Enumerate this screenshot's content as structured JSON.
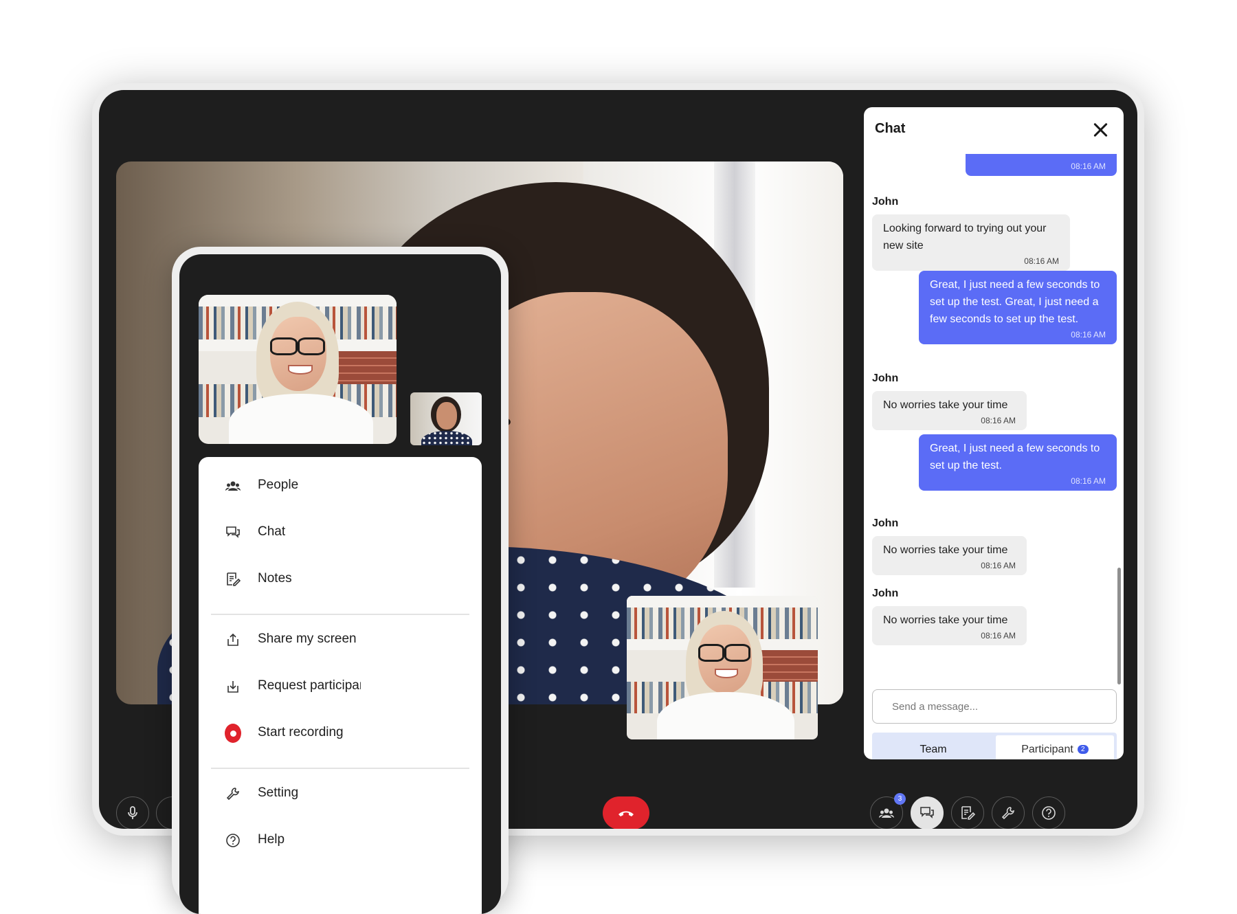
{
  "chat": {
    "title": "Chat",
    "messages": [
      {
        "sender": "",
        "text": "",
        "time": "08:16 AM",
        "own": true
      },
      {
        "sender": "John",
        "text": "Looking forward to trying out your new site",
        "time": "08:16 AM",
        "own": false
      },
      {
        "sender": "",
        "text": "Great, I just need a few seconds to set up the test. Great, I just need a few seconds to set up the test.",
        "time": "08:16 AM",
        "own": true
      },
      {
        "sender": "John",
        "text": "No worries take your time",
        "time": "08:16 AM",
        "own": false
      },
      {
        "sender": "",
        "text": "Great, I just need a few seconds to set up the test.",
        "time": "08:16 AM",
        "own": true
      },
      {
        "sender": "John",
        "text": "No worries take your time",
        "time": "08:16 AM",
        "own": false
      },
      {
        "sender": "John",
        "text": "No worries take your time",
        "time": "08:16 AM",
        "own": false
      }
    ],
    "input_placeholder": "Send a message...",
    "tabs": {
      "team": "Team",
      "participant": "Participant",
      "participant_count": "2"
    }
  },
  "controls": {
    "people_badge": "3",
    "icons": [
      "microphone-icon",
      "hang-up-icon",
      "people-icon",
      "chat-icon",
      "notes-icon",
      "settings-wrench-icon",
      "help-icon"
    ]
  },
  "phone_menu": {
    "items": [
      {
        "label": "People",
        "icon": "people-icon"
      },
      {
        "label": "Chat",
        "icon": "chat-icon"
      },
      {
        "label": "Notes",
        "icon": "notes-icon"
      },
      {
        "label": "Share my screen",
        "icon": "share-screen-icon"
      },
      {
        "label": "Request participar",
        "icon": "request-participant-icon"
      },
      {
        "label": "Start recording",
        "icon": "record-icon"
      },
      {
        "label": "Setting",
        "icon": "wrench-icon"
      },
      {
        "label": "Help",
        "icon": "help-icon"
      }
    ]
  },
  "colors": {
    "accent_blue": "#5b6cf6",
    "hangup_red": "#e0232c",
    "screen_bg": "#1e1e1e",
    "tab_bg": "#dfe6f9"
  }
}
